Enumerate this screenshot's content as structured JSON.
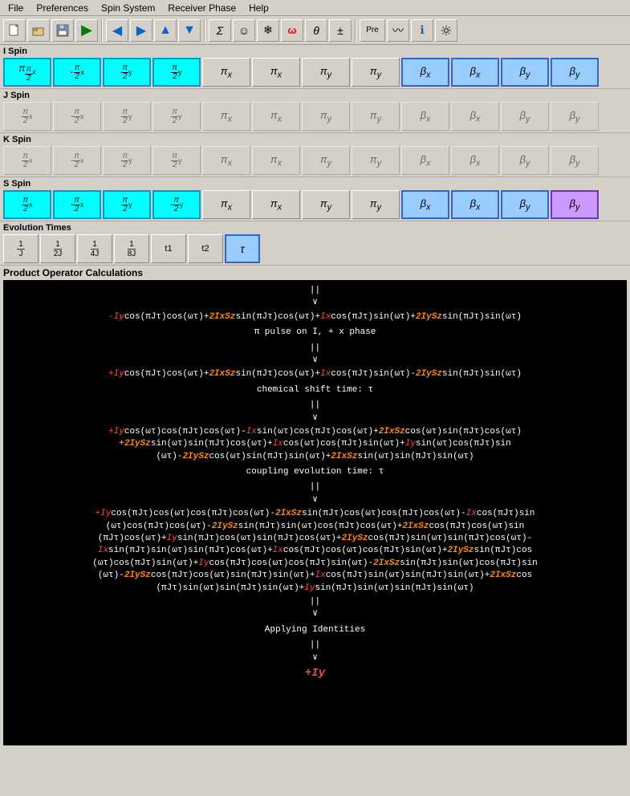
{
  "menubar": {
    "items": [
      "File",
      "Preferences",
      "Spin System",
      "Receiver Phase",
      "Help"
    ]
  },
  "toolbar": {
    "buttons": [
      {
        "name": "new",
        "icon": "📄"
      },
      {
        "name": "open",
        "icon": "📂"
      },
      {
        "name": "save",
        "icon": "💾"
      },
      {
        "name": "run",
        "icon": "▶"
      },
      {
        "name": "arrow-left",
        "icon": "◀"
      },
      {
        "name": "arrow-right",
        "icon": "▶"
      },
      {
        "name": "arrow-up",
        "icon": "▲"
      },
      {
        "name": "arrow-down",
        "icon": "▼"
      },
      {
        "name": "sigma",
        "icon": "Σ"
      },
      {
        "name": "smiley",
        "icon": "☺"
      },
      {
        "name": "snowflake",
        "icon": "❄"
      },
      {
        "name": "omega-red",
        "icon": "ω"
      },
      {
        "name": "theta",
        "icon": "θ"
      },
      {
        "name": "plusminus",
        "icon": "±"
      },
      {
        "name": "pre",
        "icon": "Pre"
      },
      {
        "name": "wave",
        "icon": "〰"
      },
      {
        "name": "info",
        "icon": "ℹ"
      },
      {
        "name": "settings",
        "icon": "⚙"
      }
    ]
  },
  "sections": {
    "iSpin": {
      "label": "I Spin",
      "buttons": [
        {
          "label": "π/2 x",
          "style": "cyan",
          "math": "pi2x"
        },
        {
          "label": "-π/2 x",
          "style": "cyan",
          "math": "npi2x"
        },
        {
          "label": "π/2 y",
          "style": "cyan",
          "math": "pi2y"
        },
        {
          "label": "π/2 y",
          "style": "cyan",
          "math": "pi2y2"
        },
        {
          "label": "πx",
          "style": "normal",
          "math": "pix"
        },
        {
          "label": "πx",
          "style": "normal",
          "math": "pix2"
        },
        {
          "label": "πy",
          "style": "normal",
          "math": "piy"
        },
        {
          "label": "πy",
          "style": "normal",
          "math": "piy2"
        },
        {
          "label": "βx",
          "style": "blue",
          "math": "bx"
        },
        {
          "label": "βx",
          "style": "blue",
          "math": "bx2"
        },
        {
          "label": "βy",
          "style": "blue",
          "math": "by"
        },
        {
          "label": "βy",
          "style": "blue",
          "math": "by2"
        }
      ]
    },
    "jSpin": {
      "label": "J Spin",
      "buttons": [
        {
          "label": "π/2 x",
          "style": "disabled",
          "math": "pi2x"
        },
        {
          "label": "-π/2 x",
          "style": "disabled",
          "math": "npi2x"
        },
        {
          "label": "π/2 y",
          "style": "disabled",
          "math": "pi2y"
        },
        {
          "label": "π/2 y",
          "style": "disabled",
          "math": "pi2y2"
        },
        {
          "label": "πx",
          "style": "disabled",
          "math": "pix"
        },
        {
          "label": "πx",
          "style": "disabled",
          "math": "pix2"
        },
        {
          "label": "πy",
          "style": "disabled",
          "math": "piy"
        },
        {
          "label": "πy",
          "style": "disabled",
          "math": "piy2"
        },
        {
          "label": "βx",
          "style": "disabled",
          "math": "bx"
        },
        {
          "label": "βx",
          "style": "disabled",
          "math": "bx2"
        },
        {
          "label": "βy",
          "style": "disabled",
          "math": "by"
        },
        {
          "label": "βy",
          "style": "disabled",
          "math": "by2"
        }
      ]
    },
    "kSpin": {
      "label": "K Spin",
      "buttons": [
        {
          "label": "π/2 x",
          "style": "disabled",
          "math": "pi2x"
        },
        {
          "label": "-π/2 x",
          "style": "disabled",
          "math": "npi2x"
        },
        {
          "label": "π/2 y",
          "style": "disabled",
          "math": "pi2y"
        },
        {
          "label": "π/2 y",
          "style": "disabled",
          "math": "pi2y2"
        },
        {
          "label": "πx",
          "style": "disabled",
          "math": "pix"
        },
        {
          "label": "πx",
          "style": "disabled",
          "math": "pix2"
        },
        {
          "label": "πy",
          "style": "disabled",
          "math": "piy"
        },
        {
          "label": "πy",
          "style": "disabled",
          "math": "piy2"
        },
        {
          "label": "βx",
          "style": "disabled",
          "math": "bx"
        },
        {
          "label": "βx",
          "style": "disabled",
          "math": "bx2"
        },
        {
          "label": "βy",
          "style": "disabled",
          "math": "by"
        },
        {
          "label": "βy",
          "style": "disabled",
          "math": "by2"
        }
      ]
    },
    "sSpin": {
      "label": "S Spin",
      "buttons": [
        {
          "label": "π/2 x",
          "style": "cyan",
          "math": "pi2x"
        },
        {
          "label": "-π/2 x",
          "style": "cyan",
          "math": "npi2x"
        },
        {
          "label": "π/2 y",
          "style": "cyan",
          "math": "pi2y"
        },
        {
          "label": "-π/2 y",
          "style": "cyan",
          "math": "npi2y"
        },
        {
          "label": "πx",
          "style": "normal",
          "math": "pix"
        },
        {
          "label": "πx",
          "style": "normal",
          "math": "pix2"
        },
        {
          "label": "πy",
          "style": "normal",
          "math": "piy"
        },
        {
          "label": "πy",
          "style": "normal",
          "math": "piy2"
        },
        {
          "label": "βx",
          "style": "blue",
          "math": "bx"
        },
        {
          "label": "βx",
          "style": "blue",
          "math": "bx2"
        },
        {
          "label": "βy",
          "style": "blue",
          "math": "by"
        },
        {
          "label": "βy",
          "style": "purple",
          "math": "by2"
        }
      ]
    },
    "evolution": {
      "label": "Evolution Times",
      "buttons": [
        {
          "label": "1/J",
          "style": "normal"
        },
        {
          "label": "1/2J",
          "style": "normal"
        },
        {
          "label": "1/4J",
          "style": "normal"
        },
        {
          "label": "1/8J",
          "style": "normal"
        },
        {
          "label": "t1",
          "style": "normal"
        },
        {
          "label": "t2",
          "style": "normal"
        },
        {
          "label": "τ",
          "style": "active"
        }
      ]
    }
  },
  "productOperator": {
    "title": "Product Operator Calculations",
    "content": "calculated"
  }
}
